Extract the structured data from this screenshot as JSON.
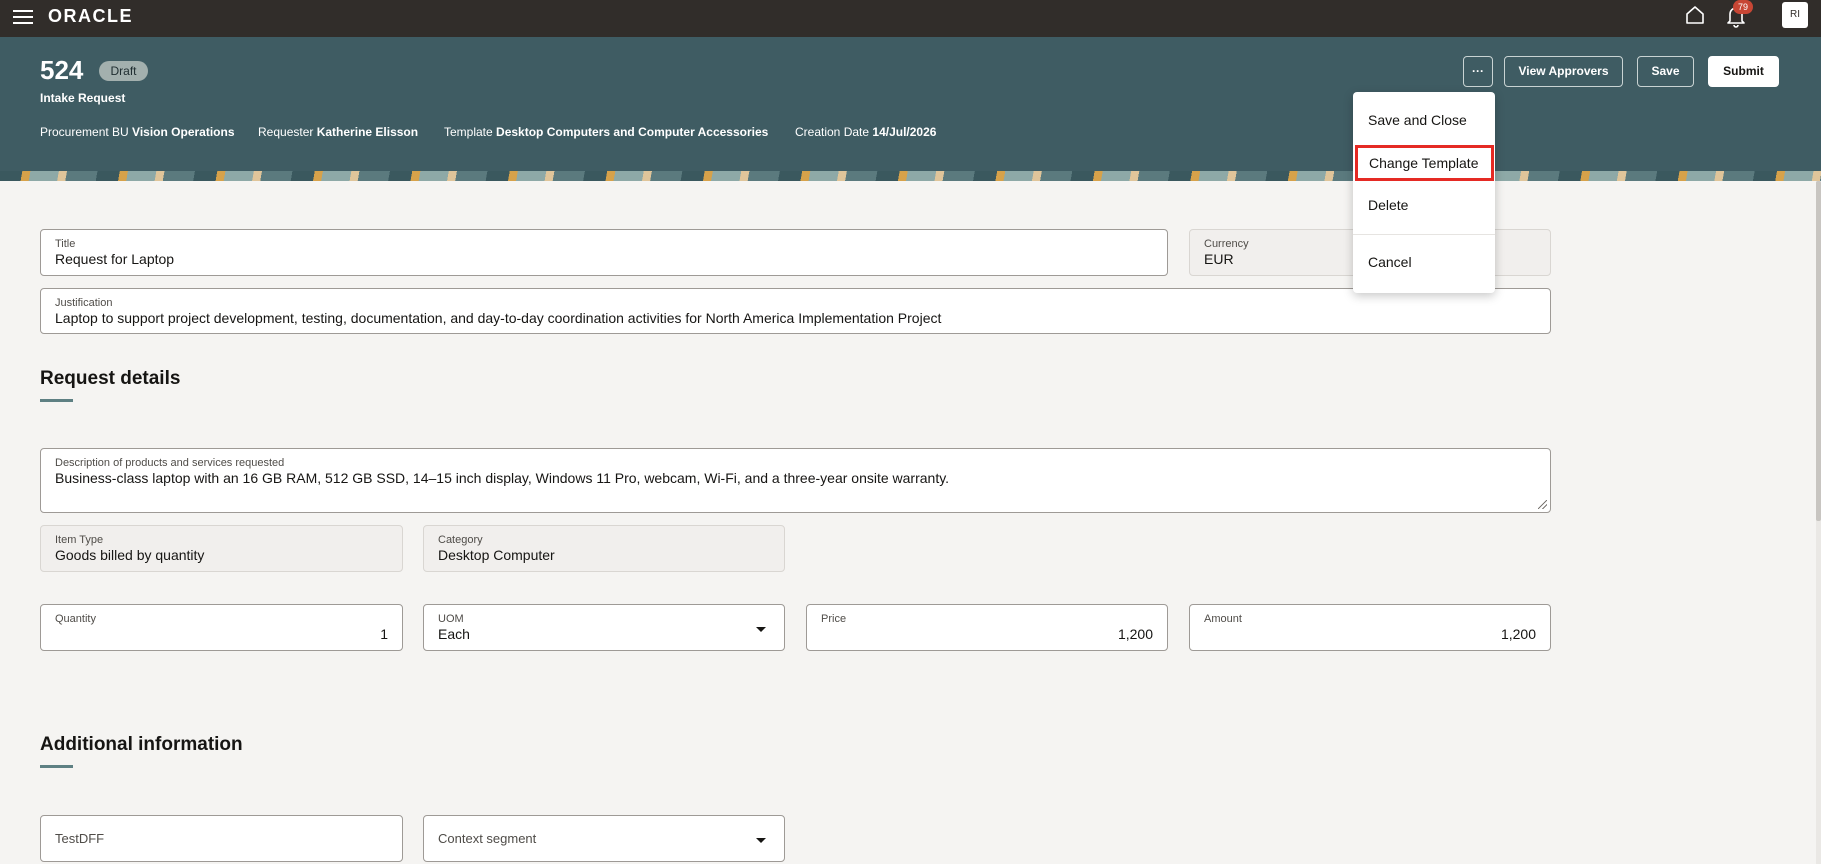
{
  "topbar": {
    "logo": "ORACLE",
    "notification_count": "79",
    "avatar_initials": "RI",
    "icons": [
      "menu-icon",
      "home-icon",
      "bell-icon"
    ]
  },
  "header": {
    "request_number": "524",
    "status": "Draft",
    "request_type": "Intake Request",
    "procurement_bu_label": "Procurement BU",
    "procurement_bu_value": "Vision Operations",
    "requester_label": "Requester",
    "requester_value": "Katherine Elisson",
    "template_label": "Template",
    "template_value": "Desktop Computers and Computer Accessories",
    "creation_date_label": "Creation Date",
    "creation_date_value": "14/Jul/2026",
    "buttons": {
      "more": "···",
      "view_approvers": "View Approvers",
      "save": "Save",
      "submit": "Submit"
    }
  },
  "menu": {
    "items": [
      "Save and Close",
      "Change Template",
      "Delete",
      "Cancel"
    ],
    "highlighted": "Change Template",
    "highlight_color": "#e52a24"
  },
  "form": {
    "title": {
      "label": "Title",
      "value": "Request for Laptop"
    },
    "currency": {
      "label": "Currency",
      "value": "EUR"
    },
    "justification": {
      "label": "Justification",
      "value": "Laptop to support project development, testing, documentation, and day-to-day coordination activities for North America Implementation Project"
    }
  },
  "request_details": {
    "heading": "Request details",
    "description": {
      "label": "Description of products and services requested",
      "value": "Business-class laptop with an 16 GB RAM, 512 GB SSD, 14–15 inch display, Windows 11 Pro, webcam, Wi-Fi, and a three-year onsite warranty."
    },
    "item_type": {
      "label": "Item Type",
      "value": "Goods billed by quantity"
    },
    "category": {
      "label": "Category",
      "value": "Desktop Computer"
    },
    "quantity": {
      "label": "Quantity",
      "value": "1"
    },
    "uom": {
      "label": "UOM",
      "value": "Each"
    },
    "price": {
      "label": "Price",
      "value": "1,200"
    },
    "amount": {
      "label": "Amount",
      "value": "1,200"
    }
  },
  "additional_info": {
    "heading": "Additional information",
    "testdff_placeholder": "TestDFF",
    "context_segment_placeholder": "Context segment"
  },
  "colors": {
    "topbar": "#312d2a",
    "header": "#3f5c63",
    "accent_bar": "#5e8083",
    "badge": "#c74634"
  }
}
